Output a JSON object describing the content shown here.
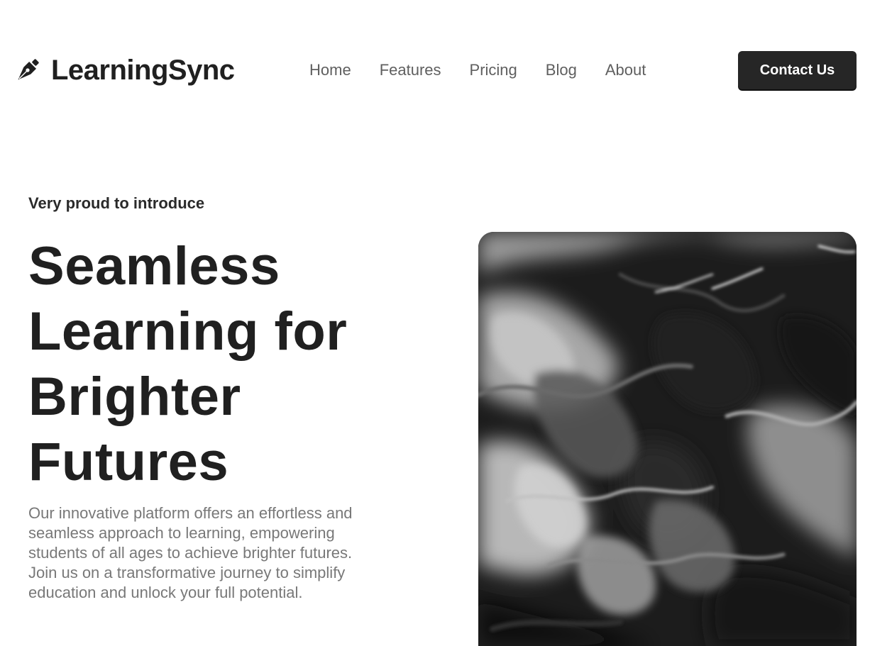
{
  "brand": {
    "name": "LearningSync",
    "logo_icon": "pen-nib-icon"
  },
  "nav": {
    "items": [
      {
        "label": "Home"
      },
      {
        "label": "Features"
      },
      {
        "label": "Pricing"
      },
      {
        "label": "Blog"
      },
      {
        "label": "About"
      }
    ],
    "contact_label": "Contact Us"
  },
  "hero": {
    "eyebrow": "Very proud to introduce",
    "title_lines": [
      "Seamless",
      "Learning for",
      "Brighter",
      "Futures"
    ],
    "description": "Our innovative platform offers an effortless and seamless approach to learning, empowering students of all ages to achieve brighter futures. Join us on a transformative journey to simplify education and unlock your full potential.",
    "image": "grayscale-fluid-abstract-image"
  },
  "colors": {
    "text_primary": "#202020",
    "nav_text": "#5f5f5f",
    "description_text": "#787878",
    "button_bg": "#262626",
    "button_text": "#ffffff"
  }
}
